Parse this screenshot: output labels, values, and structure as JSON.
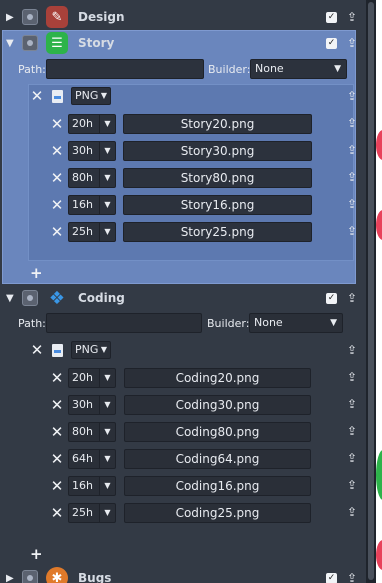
{
  "sections": {
    "design": {
      "title": "Design",
      "icon": "brush-icon",
      "checked": true
    },
    "story": {
      "title": "Story",
      "icon": "notes-icon",
      "checked": true,
      "path_label": "Path:",
      "path_value": "",
      "builder_label": "Builder:",
      "builder_value": "None",
      "format": "PNG",
      "items": [
        {
          "size": "20h",
          "file": "Story20.png"
        },
        {
          "size": "30h",
          "file": "Story30.png"
        },
        {
          "size": "80h",
          "file": "Story80.png"
        },
        {
          "size": "16h",
          "file": "Story16.png"
        },
        {
          "size": "25h",
          "file": "Story25.png"
        }
      ]
    },
    "coding": {
      "title": "Coding",
      "icon": "cubes-icon",
      "checked": true,
      "path_label": "Path:",
      "path_value": "",
      "builder_label": "Builder:",
      "builder_value": "None",
      "format": "PNG",
      "items": [
        {
          "size": "20h",
          "file": "Coding20.png"
        },
        {
          "size": "30h",
          "file": "Coding30.png"
        },
        {
          "size": "80h",
          "file": "Coding80.png"
        },
        {
          "size": "64h",
          "file": "Coding64.png"
        },
        {
          "size": "16h",
          "file": "Coding16.png"
        },
        {
          "size": "25h",
          "file": "Coding25.png"
        }
      ]
    },
    "bugs": {
      "title": "Bugs",
      "icon": "bug-icon",
      "checked": true
    }
  },
  "colors": {
    "panel": "#333a45",
    "selected_section": "#6a86bd",
    "field": "#2a2f38"
  }
}
